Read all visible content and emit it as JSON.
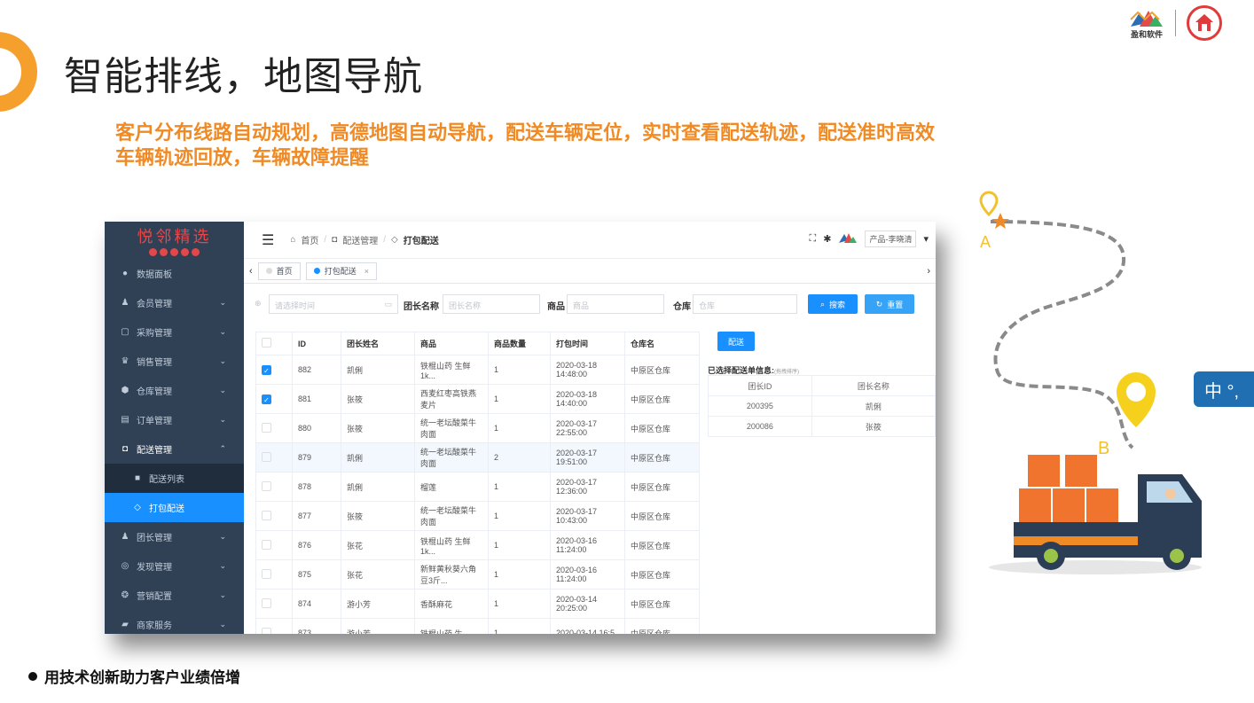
{
  "slide": {
    "title": "智能排线，地图导航",
    "subtitle_line1": "客户分布线路自动规划，高德地图自动导航，配送车辆定位，实时查看配送轨迹，配送准时高效",
    "subtitle_line2": "车辆轨迹回放，车辆故障提醒",
    "footer": "用技术创新助力客户业绩倍增",
    "logo_left_text": "盈和软件",
    "bubble_text": "中 °,",
    "map_marker_a": "A",
    "map_marker_b": "B",
    "colors": {
      "accent_orange": "#f08a24",
      "primary_blue": "#1890ff",
      "sidebar_bg": "#304156"
    }
  },
  "app": {
    "brand": "悦邻精选",
    "sidebar": {
      "items": [
        {
          "label": "数据面板",
          "icon": "dashboard-icon"
        },
        {
          "label": "会员管理",
          "icon": "members-icon"
        },
        {
          "label": "采购管理",
          "icon": "purchase-icon"
        },
        {
          "label": "销售管理",
          "icon": "sales-icon"
        },
        {
          "label": "仓库管理",
          "icon": "warehouse-icon"
        },
        {
          "label": "订单管理",
          "icon": "orders-icon"
        },
        {
          "label": "配送管理",
          "icon": "delivery-icon"
        },
        {
          "label": "配送列表",
          "icon": "list-icon"
        },
        {
          "label": "打包配送",
          "icon": "package-icon"
        },
        {
          "label": "团长管理",
          "icon": "leaders-icon"
        },
        {
          "label": "发现管理",
          "icon": "discover-icon"
        },
        {
          "label": "营销配置",
          "icon": "marketing-icon"
        },
        {
          "label": "商家服务",
          "icon": "merchant-icon"
        }
      ]
    },
    "breadcrumb": {
      "home": "首页",
      "section": "配送管理",
      "current": "打包配送"
    },
    "user_select": "产品-李晓清",
    "tabs": [
      "首页",
      "打包配送"
    ],
    "filters": {
      "time_placeholder": "请选择时间",
      "leader_label": "团长名称",
      "leader_placeholder": "团长名称",
      "goods_label": "商品",
      "goods_placeholder": "商品",
      "warehouse_label": "仓库",
      "warehouse_placeholder": "仓库",
      "search_btn": "搜索",
      "reset_btn": "重置"
    },
    "table": {
      "headers": [
        "ID",
        "团长姓名",
        "商品",
        "商品数量",
        "打包时间",
        "仓库名"
      ],
      "rows": [
        {
          "id": "882",
          "leader": "凯俐",
          "goods": "铁棍山药 生鲜1k...",
          "qty": "1",
          "time": "2020-03-18 14:48:00",
          "wh": "中原区仓库",
          "checked": true
        },
        {
          "id": "881",
          "leader": "张筱",
          "goods": "西麦红枣高铁燕麦片",
          "qty": "1",
          "time": "2020-03-18 14:40:00",
          "wh": "中原区仓库",
          "checked": true
        },
        {
          "id": "880",
          "leader": "张筱",
          "goods": "统一老坛酸菜牛肉面",
          "qty": "1",
          "time": "2020-03-17 22:55:00",
          "wh": "中原区仓库",
          "checked": false
        },
        {
          "id": "879",
          "leader": "凯俐",
          "goods": "统一老坛酸菜牛肉面",
          "qty": "2",
          "time": "2020-03-17 19:51:00",
          "wh": "中原区仓库",
          "checked": false
        },
        {
          "id": "878",
          "leader": "凯俐",
          "goods": "榴莲",
          "qty": "1",
          "time": "2020-03-17 12:36:00",
          "wh": "中原区仓库",
          "checked": false
        },
        {
          "id": "877",
          "leader": "张筱",
          "goods": "统一老坛酸菜牛肉面",
          "qty": "1",
          "time": "2020-03-17 10:43:00",
          "wh": "中原区仓库",
          "checked": false
        },
        {
          "id": "876",
          "leader": "张花",
          "goods": "铁棍山药 生鲜1k...",
          "qty": "1",
          "time": "2020-03-16 11:24:00",
          "wh": "中原区仓库",
          "checked": false
        },
        {
          "id": "875",
          "leader": "张花",
          "goods": "新鲜黄秋葵六角豆3斤...",
          "qty": "1",
          "time": "2020-03-16 11:24:00",
          "wh": "中原区仓库",
          "checked": false
        },
        {
          "id": "874",
          "leader": "游小芳",
          "goods": "香酥麻花",
          "qty": "1",
          "time": "2020-03-14 20:25:00",
          "wh": "中原区仓库",
          "checked": false
        },
        {
          "id": "873",
          "leader": "游小芳",
          "goods": "铁棍山药 生",
          "qty": "1",
          "time": "2020-03-14 16:5",
          "wh": "中原区仓库",
          "checked": false
        }
      ]
    },
    "send_btn": "配送",
    "selected": {
      "title": "已选择配送单信息:",
      "hint": "拖拽排序",
      "headers": [
        "团长ID",
        "团长名称"
      ],
      "rows": [
        {
          "id": "200395",
          "name": "凯俐"
        },
        {
          "id": "200086",
          "name": "张筱"
        }
      ]
    }
  }
}
